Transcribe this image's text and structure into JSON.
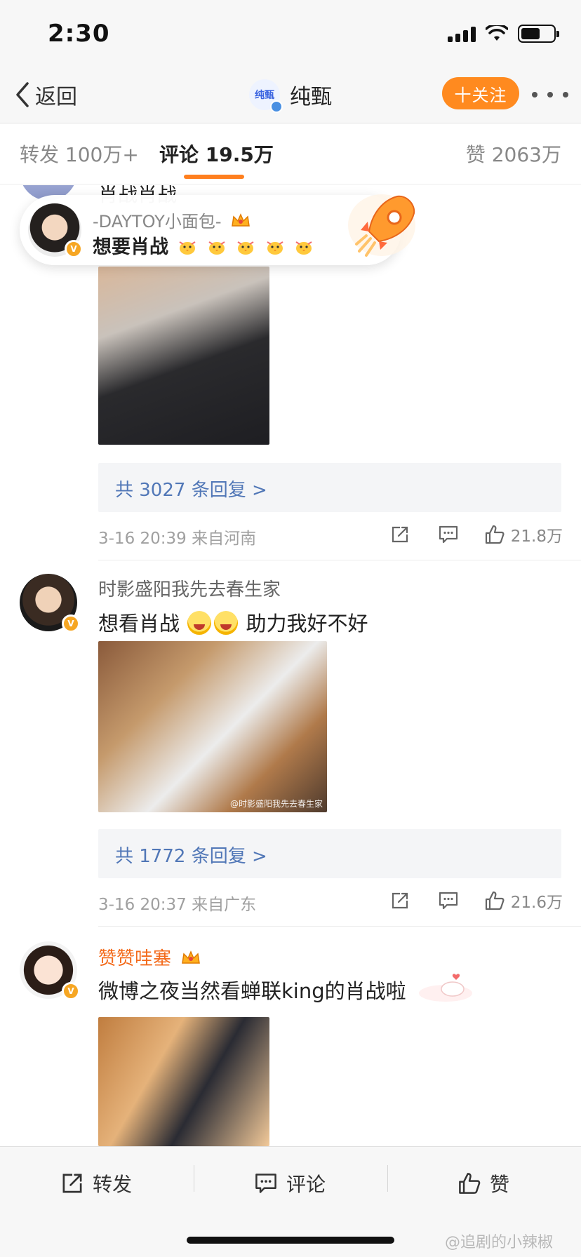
{
  "status_bar": {
    "time": "2:30"
  },
  "nav": {
    "back_label": "返回",
    "title": "纯甄",
    "avatar_text": "纯甄",
    "follow_label": "十关注"
  },
  "tabs": {
    "repost": "转发 100万+",
    "comment": "评论 19.5万",
    "like": "赞 2063万"
  },
  "partial_comment": {
    "text": "肖战肖战"
  },
  "toast": {
    "name": "-DAYTOY小面包-",
    "text": "想要肖战"
  },
  "comments": [
    {
      "reply_summary": "共 3027 条回复 >",
      "date": "3-16 20:39",
      "location": "来自河南",
      "meta": "3-16 20:39  来自河南",
      "likes": "21.8万"
    },
    {
      "name": "时影盛阳我先去春生家",
      "text_before": "想看肖战",
      "text_after": "助力我好不好",
      "image_caption": "@时影盛阳我先去春生家",
      "reply_summary": "共 1772 条回复 >",
      "meta": "3-16 20:37  来自广东",
      "likes": "21.6万"
    },
    {
      "name": "赞赞哇塞",
      "text": "微博之夜当然看蝉联king的肖战啦"
    }
  ],
  "bottom_bar": {
    "repost": "转发",
    "comment": "评论",
    "like": "赞"
  },
  "watermark": "@追剧的小辣椒",
  "colors": {
    "accent": "#ff8a1f",
    "link": "#5177b7",
    "vip_name": "#f36b1c",
    "tab_indicator": "#ff7f1e"
  }
}
